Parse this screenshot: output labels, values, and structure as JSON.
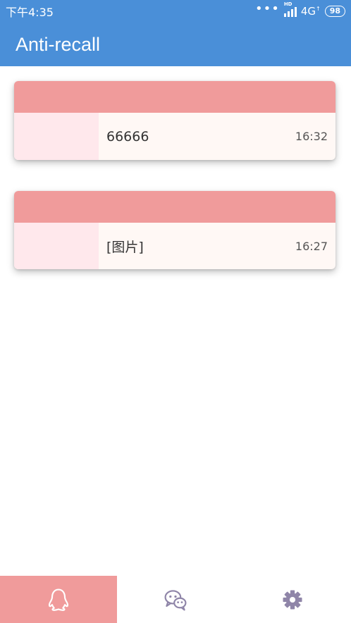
{
  "status_bar": {
    "time": "下午4:35",
    "signal_label": "HD",
    "network": "4G",
    "battery": "98"
  },
  "app_bar": {
    "title": "Anti-recall"
  },
  "messages": [
    {
      "text": "66666",
      "time": "16:32"
    },
    {
      "text": "[图片]",
      "time": "16:27"
    }
  ],
  "bottom_nav": {
    "tabs": [
      {
        "icon": "qq-penguin-icon",
        "active": true
      },
      {
        "icon": "wechat-icon",
        "active": false
      },
      {
        "icon": "gear-icon",
        "active": false
      }
    ]
  },
  "colors": {
    "primary": "#4a8fd8",
    "accent": "#f09b9b",
    "avatar_bg": "#ffe8ec",
    "card_bg": "#fff8f5",
    "icon_inactive": "#8f85a8"
  }
}
